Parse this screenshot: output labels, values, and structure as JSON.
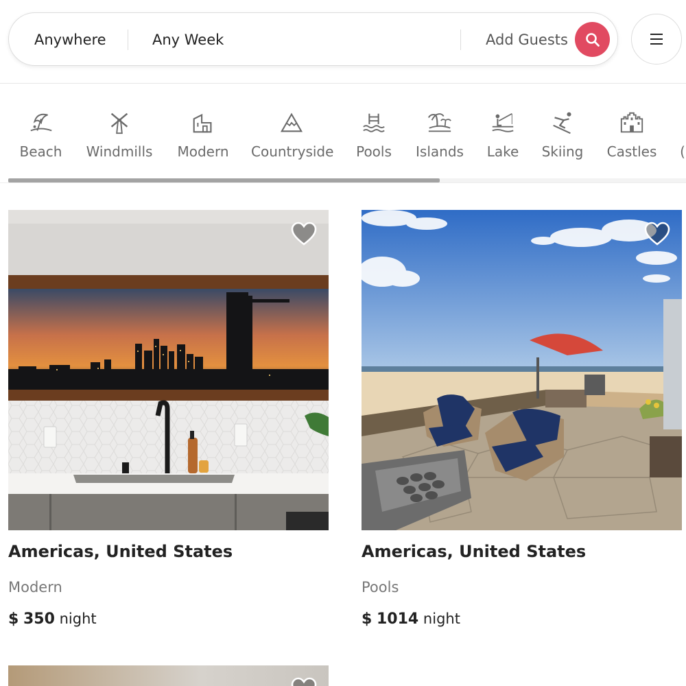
{
  "search": {
    "where_label": "Anywhere",
    "week_label": "Any Week",
    "guests_label": "Add Guests"
  },
  "categories": [
    {
      "label": "Beach",
      "icon": "beach-umbrella-icon"
    },
    {
      "label": "Windmills",
      "icon": "windmill-icon"
    },
    {
      "label": "Modern",
      "icon": "modern-house-icon"
    },
    {
      "label": "Countryside",
      "icon": "mountain-icon"
    },
    {
      "label": "Pools",
      "icon": "pool-ladder-icon"
    },
    {
      "label": "Islands",
      "icon": "palm-island-icon"
    },
    {
      "label": "Lake",
      "icon": "fishing-lake-icon"
    },
    {
      "label": "Skiing",
      "icon": "skier-icon"
    },
    {
      "label": "Castles",
      "icon": "castle-icon"
    }
  ],
  "listings": [
    {
      "location": "Americas, United States",
      "category": "Modern",
      "currency": "$",
      "price": "350",
      "unit": "night"
    },
    {
      "location": "Americas, United States",
      "category": "Pools",
      "currency": "$",
      "price": "1014",
      "unit": "night"
    }
  ],
  "colors": {
    "accent": "#e14a61",
    "muted_text": "#6a6a6a"
  }
}
